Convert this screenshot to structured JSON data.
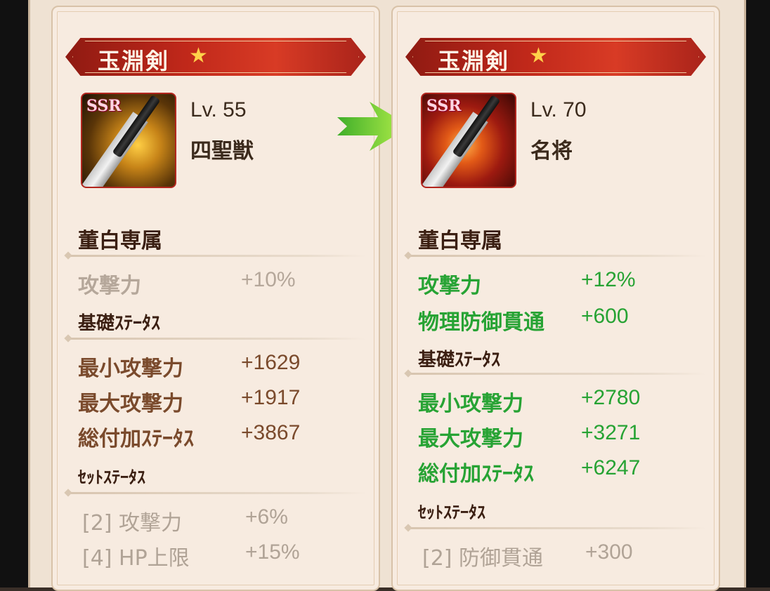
{
  "colors": {
    "bonus_green": "#27a334",
    "inactive_gray": "#b5a79a",
    "stat_brown": "#7a4a2c",
    "banner_red": "#c0281a"
  },
  "before": {
    "title": "玉淵剣",
    "rarity": "SSR",
    "level": "Lv. 55",
    "rank": "四聖獣",
    "exclusive_header": "董白専属",
    "exclusive": [
      {
        "label": "攻撃力",
        "value": "+10%"
      }
    ],
    "base_header": "基礎ｽﾃｰﾀｽ",
    "base": [
      {
        "label": "最小攻撃力",
        "value": "+1629"
      },
      {
        "label": "最大攻撃力",
        "value": "+1917"
      },
      {
        "label": "総付加ｽﾃｰﾀｽ",
        "value": "+3867"
      }
    ],
    "set_header": "ｾｯﾄｽﾃｰﾀｽ",
    "set": [
      {
        "label": "[2] 攻撃力",
        "value": "+6%"
      },
      {
        "label": "[4] HP上限",
        "value": "+15%"
      }
    ]
  },
  "after": {
    "title": "玉淵剣",
    "rarity": "SSR",
    "level": "Lv. 70",
    "rank": "名将",
    "exclusive_header": "董白専属",
    "exclusive": [
      {
        "label": "攻撃力",
        "value": "+12%"
      },
      {
        "label": "物理防御貫通",
        "value": "+600"
      }
    ],
    "base_header": "基礎ｽﾃｰﾀｽ",
    "base": [
      {
        "label": "最小攻撃力",
        "value": "+2780"
      },
      {
        "label": "最大攻撃力",
        "value": "+3271"
      },
      {
        "label": "総付加ｽﾃｰﾀｽ",
        "value": "+6247"
      }
    ],
    "set_header": "ｾｯﾄｽﾃｰﾀｽ",
    "set": [
      {
        "label": "[2] 防御貫通",
        "value": "+300"
      }
    ]
  },
  "icons": {
    "star": "star-icon",
    "arrow": "arrow-right-icon",
    "weapon": "sword-icon"
  }
}
